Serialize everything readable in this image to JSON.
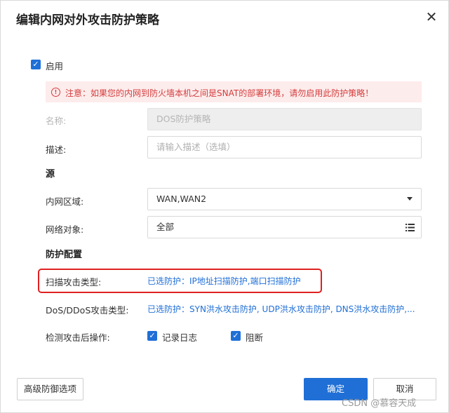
{
  "dialog": {
    "title": "编辑内网对外攻击防护策略",
    "close_glyph": "✕"
  },
  "enable": {
    "label": "启用",
    "checked": true
  },
  "warning": {
    "icon": "!",
    "text": "注意：如果您的内网到防火墙本机之间是SNAT的部署环境，请勿启用此防护策略！",
    "color": "#d43c3c"
  },
  "form": {
    "name_label": "名称:",
    "name_value": "DOS防护策略",
    "desc_label": "描述:",
    "desc_placeholder": "请输入描述（选填）"
  },
  "source": {
    "section_title": "源",
    "zone_label": "内网区域:",
    "zone_value": "WAN,WAN2",
    "network_label": "网络对象:",
    "network_value": "全部"
  },
  "protection": {
    "section_title": "防护配置",
    "scan_label": "扫描攻击类型:",
    "scan_value": "已选防护：IP地址扫描防护,端口扫描防护",
    "dos_label": "DoS/DDoS攻击类型:",
    "dos_value": "已选防护：SYN洪水攻击防护, UDP洪水攻击防护, DNS洪水攻击防护,...",
    "action_label": "检测攻击后操作:",
    "log_label": "记录日志",
    "log_checked": true,
    "block_label": "阻断",
    "block_checked": true
  },
  "footer": {
    "advanced_label": "高级防御选项",
    "ok_label": "确定",
    "cancel_label": "取消"
  },
  "watermark": "CSDN @慕容天成",
  "colors": {
    "accent": "#1f6fd6",
    "warning_bg": "#fdecec",
    "highlight": "#e02020"
  }
}
